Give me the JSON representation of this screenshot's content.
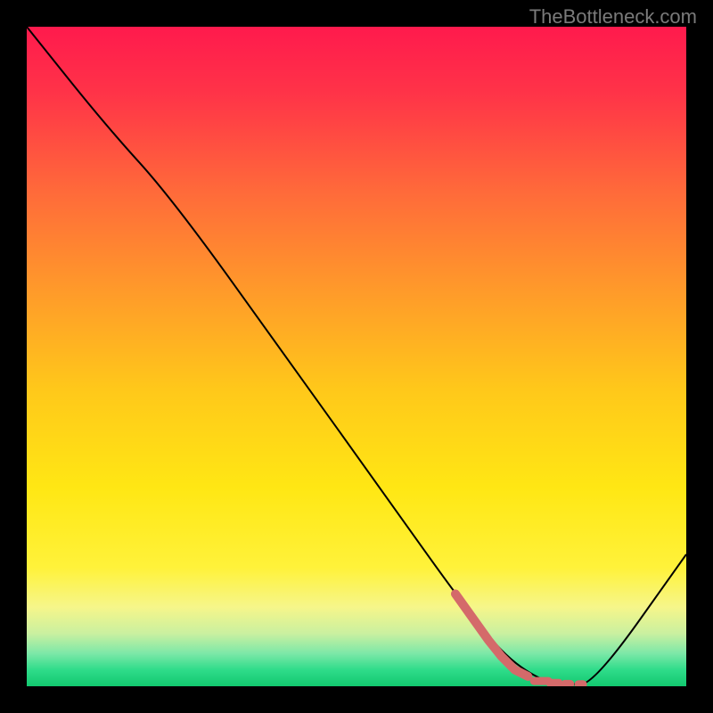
{
  "watermark": "TheBottleneck.com",
  "chart_data": {
    "type": "line",
    "title": "",
    "xlabel": "",
    "ylabel": "",
    "xlim": [
      0,
      100
    ],
    "ylim": [
      0,
      100
    ],
    "series": [
      {
        "name": "main-curve",
        "color": "#000000",
        "x": [
          0,
          12,
          22,
          40,
          55,
          65,
          72,
          78,
          82,
          86,
          100
        ],
        "y": [
          100,
          85,
          74,
          49,
          28,
          14,
          5,
          0.8,
          0.3,
          0.3,
          20
        ]
      },
      {
        "name": "highlight-segment",
        "color": "#d46a6a",
        "style": "thick-then-dashed",
        "x": [
          65,
          70,
          72,
          74,
          76,
          78,
          80,
          82,
          84
        ],
        "y": [
          14,
          7,
          4.5,
          2.5,
          1.5,
          0.8,
          0.5,
          0.35,
          0.3
        ]
      }
    ],
    "gradient_stops": [
      {
        "offset": 0.0,
        "color": "#ff1a4d"
      },
      {
        "offset": 0.1,
        "color": "#ff3348"
      },
      {
        "offset": 0.25,
        "color": "#ff6a3a"
      },
      {
        "offset": 0.4,
        "color": "#ff9a2a"
      },
      {
        "offset": 0.55,
        "color": "#ffc81a"
      },
      {
        "offset": 0.7,
        "color": "#ffe714"
      },
      {
        "offset": 0.82,
        "color": "#fff23a"
      },
      {
        "offset": 0.88,
        "color": "#f6f68a"
      },
      {
        "offset": 0.92,
        "color": "#caf0a0"
      },
      {
        "offset": 0.95,
        "color": "#7de8a8"
      },
      {
        "offset": 0.975,
        "color": "#2fdc8a"
      },
      {
        "offset": 1.0,
        "color": "#12c86f"
      }
    ]
  }
}
